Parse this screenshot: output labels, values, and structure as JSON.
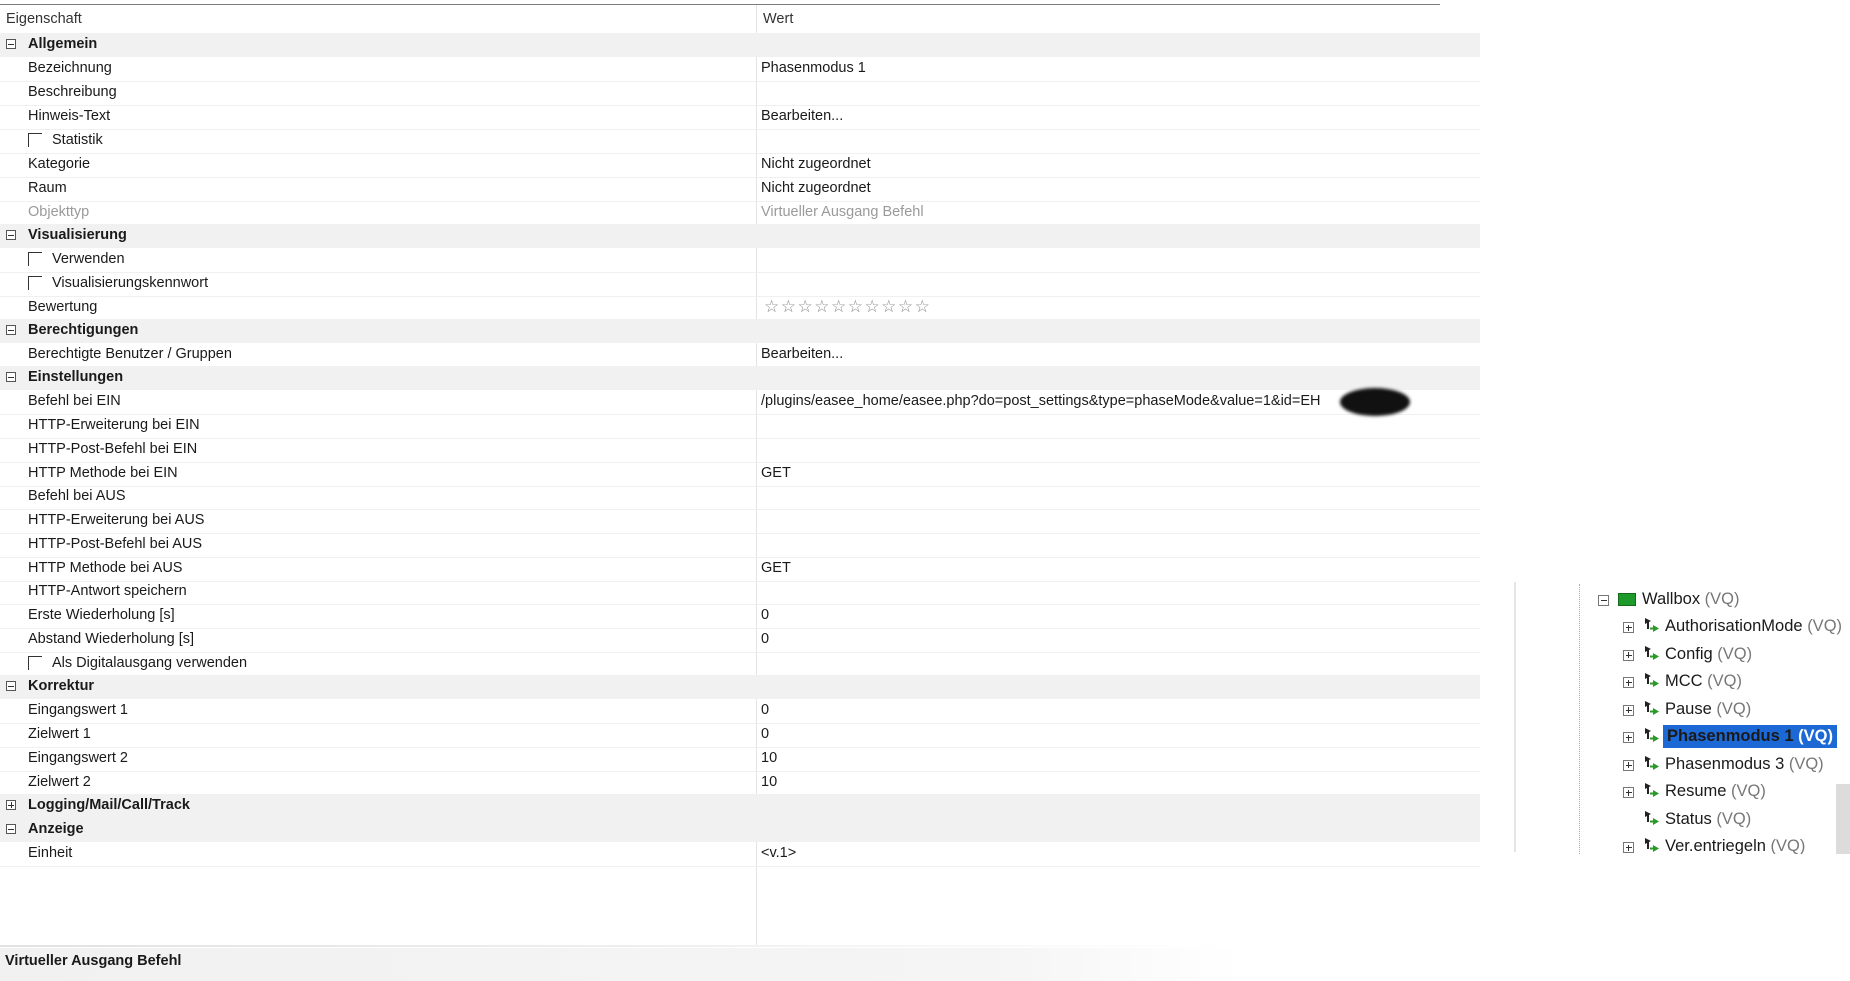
{
  "header": {
    "col_property": "Eigenschaft",
    "col_value": "Wert"
  },
  "groups": {
    "allgemein": "Allgemein",
    "visualisierung": "Visualisierung",
    "berechtigungen": "Berechtigungen",
    "einstellungen": "Einstellungen",
    "korrektur": "Korrektur",
    "logging": "Logging/Mail/Call/Track",
    "anzeige": "Anzeige"
  },
  "props": {
    "bezeichnung": {
      "label": "Bezeichnung",
      "value": "Phasenmodus 1"
    },
    "beschreibung": {
      "label": "Beschreibung",
      "value": ""
    },
    "hinweis": {
      "label": "Hinweis-Text",
      "value": "Bearbeiten..."
    },
    "statistik": {
      "label": "Statistik",
      "checked": false
    },
    "kategorie": {
      "label": "Kategorie",
      "value": "Nicht zugeordnet"
    },
    "raum": {
      "label": "Raum",
      "value": "Nicht zugeordnet"
    },
    "objekttyp": {
      "label": "Objekttyp",
      "value": "Virtueller Ausgang Befehl"
    },
    "verwenden": {
      "label": "Verwenden",
      "checked": false
    },
    "viskennwort": {
      "label": "Visualisierungskennwort",
      "checked": false
    },
    "bewertung": {
      "label": "Bewertung",
      "stars": "☆☆☆☆☆☆☆☆☆☆",
      "rating": 0,
      "max": 10
    },
    "benutzer": {
      "label": "Berechtigte Benutzer / Gruppen",
      "value": "Bearbeiten..."
    },
    "befehl_ein": {
      "label": "Befehl bei EIN",
      "value": "/plugins/easee_home/easee.php?do=post_settings&type=phaseMode&value=1&id=EH"
    },
    "http_erw_ein": {
      "label": "HTTP-Erweiterung bei EIN",
      "value": ""
    },
    "http_post_ein": {
      "label": "HTTP-Post-Befehl bei EIN",
      "value": ""
    },
    "http_meth_ein": {
      "label": "HTTP Methode bei EIN",
      "value": "GET"
    },
    "befehl_aus": {
      "label": "Befehl bei AUS",
      "value": ""
    },
    "http_erw_aus": {
      "label": "HTTP-Erweiterung bei AUS",
      "value": ""
    },
    "http_post_aus": {
      "label": "HTTP-Post-Befehl bei AUS",
      "value": ""
    },
    "http_meth_aus": {
      "label": "HTTP Methode bei AUS",
      "value": "GET"
    },
    "http_antwort": {
      "label": "HTTP-Antwort speichern",
      "value": ""
    },
    "erste_wdh": {
      "label": "Erste Wiederholung [s]",
      "value": "0"
    },
    "abstand_wdh": {
      "label": "Abstand Wiederholung [s]",
      "value": "0"
    },
    "digitalausgang": {
      "label": "Als Digitalausgang verwenden",
      "checked": false
    },
    "eingang1": {
      "label": "Eingangswert 1",
      "value": "0"
    },
    "ziel1": {
      "label": "Zielwert 1",
      "value": "0"
    },
    "eingang2": {
      "label": "Eingangswert 2",
      "value": "10"
    },
    "ziel2": {
      "label": "Zielwert 2",
      "value": "10"
    },
    "einheit": {
      "label": "Einheit",
      "value": "<v.1>"
    }
  },
  "footer": {
    "text": "Virtueller Ausgang Befehl"
  },
  "tree": {
    "root": {
      "name": "Wallbox",
      "tag": "(VQ)"
    },
    "items": [
      {
        "name": "AuthorisationMode",
        "tag": "(VQ)"
      },
      {
        "name": "Config",
        "tag": "(VQ)"
      },
      {
        "name": "MCC",
        "tag": "(VQ)"
      },
      {
        "name": "Pause",
        "tag": "(VQ)"
      },
      {
        "name": "Phasenmodus 1",
        "tag": "(VQ)"
      },
      {
        "name": "Phasenmodus 3",
        "tag": "(VQ)"
      },
      {
        "name": "Resume",
        "tag": "(VQ)"
      },
      {
        "name": "Status",
        "tag": "(VQ)"
      },
      {
        "name": "Ver.entriegeln",
        "tag": "(VQ)"
      }
    ],
    "selected": "Phasenmodus 1 (VQ)"
  },
  "colors": {
    "selection": "#1c68d4",
    "category_bg": "#f1f1f1",
    "wallbox_icon": "#1e9a2a"
  }
}
